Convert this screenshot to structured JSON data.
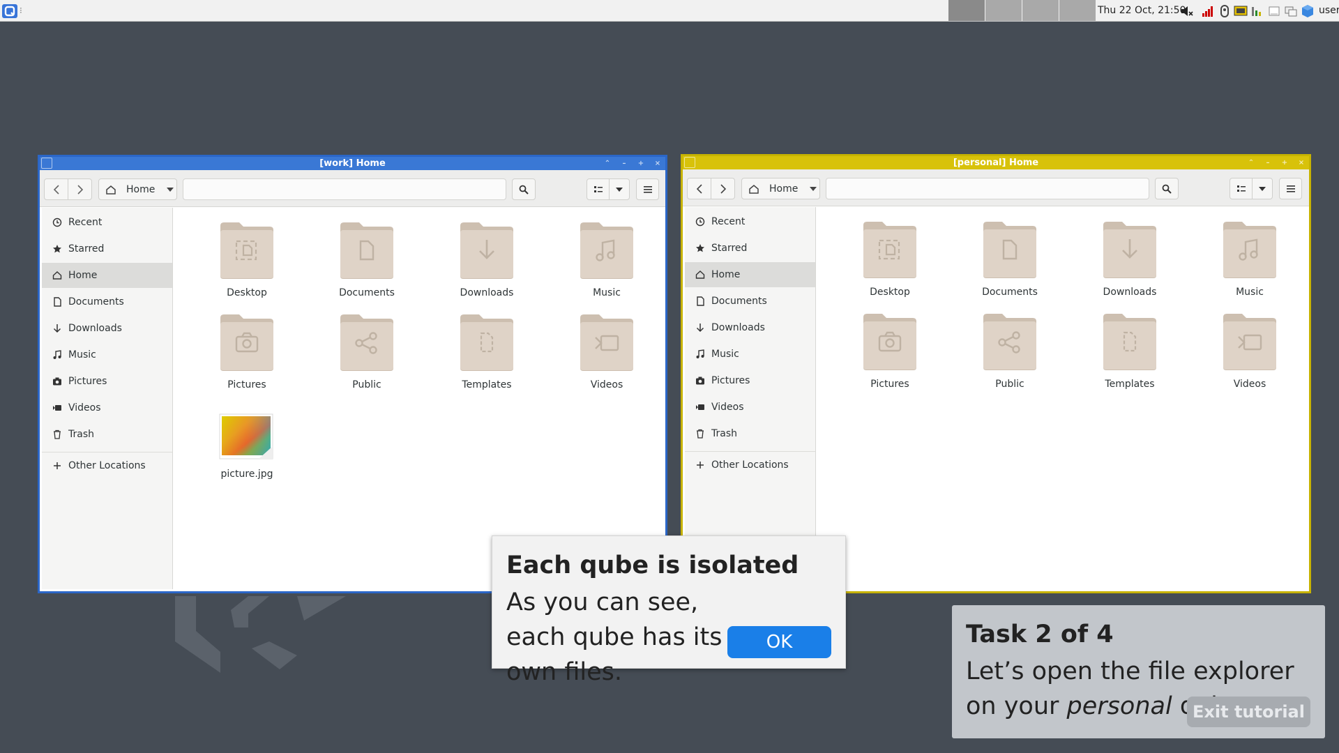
{
  "panel": {
    "clock": "Thu 22 Oct, 21:50",
    "user": "user",
    "workspaces": 4
  },
  "windows": [
    {
      "id": "work",
      "title": "[work] Home",
      "color": "#3a78d5",
      "path_label": "Home",
      "sidebar": [
        "Recent",
        "Starred",
        "Home",
        "Documents",
        "Downloads",
        "Music",
        "Pictures",
        "Videos",
        "Trash"
      ],
      "other_locations": "Other Locations",
      "folders": [
        "Desktop",
        "Documents",
        "Downloads",
        "Music",
        "Pictures",
        "Public",
        "Templates",
        "Videos"
      ],
      "files": [
        "picture.jpg"
      ]
    },
    {
      "id": "personal",
      "title": "[personal] Home",
      "color": "#d8c20a",
      "path_label": "Home",
      "sidebar": [
        "Recent",
        "Starred",
        "Home",
        "Documents",
        "Downloads",
        "Music",
        "Pictures",
        "Videos",
        "Trash"
      ],
      "other_locations": "Other Locations",
      "folders": [
        "Desktop",
        "Documents",
        "Downloads",
        "Music",
        "Pictures",
        "Public",
        "Templates",
        "Videos"
      ],
      "files": []
    }
  ],
  "dialog": {
    "title": "Each qube is isolated",
    "body": "As you can see, each qube has its own files.",
    "ok": "OK"
  },
  "task": {
    "title": "Task 2 of 4",
    "body_prefix": "Let’s open the file explorer on your ",
    "body_emph": "personal",
    "body_suffix": " qube",
    "exit": "Exit tutorial"
  }
}
